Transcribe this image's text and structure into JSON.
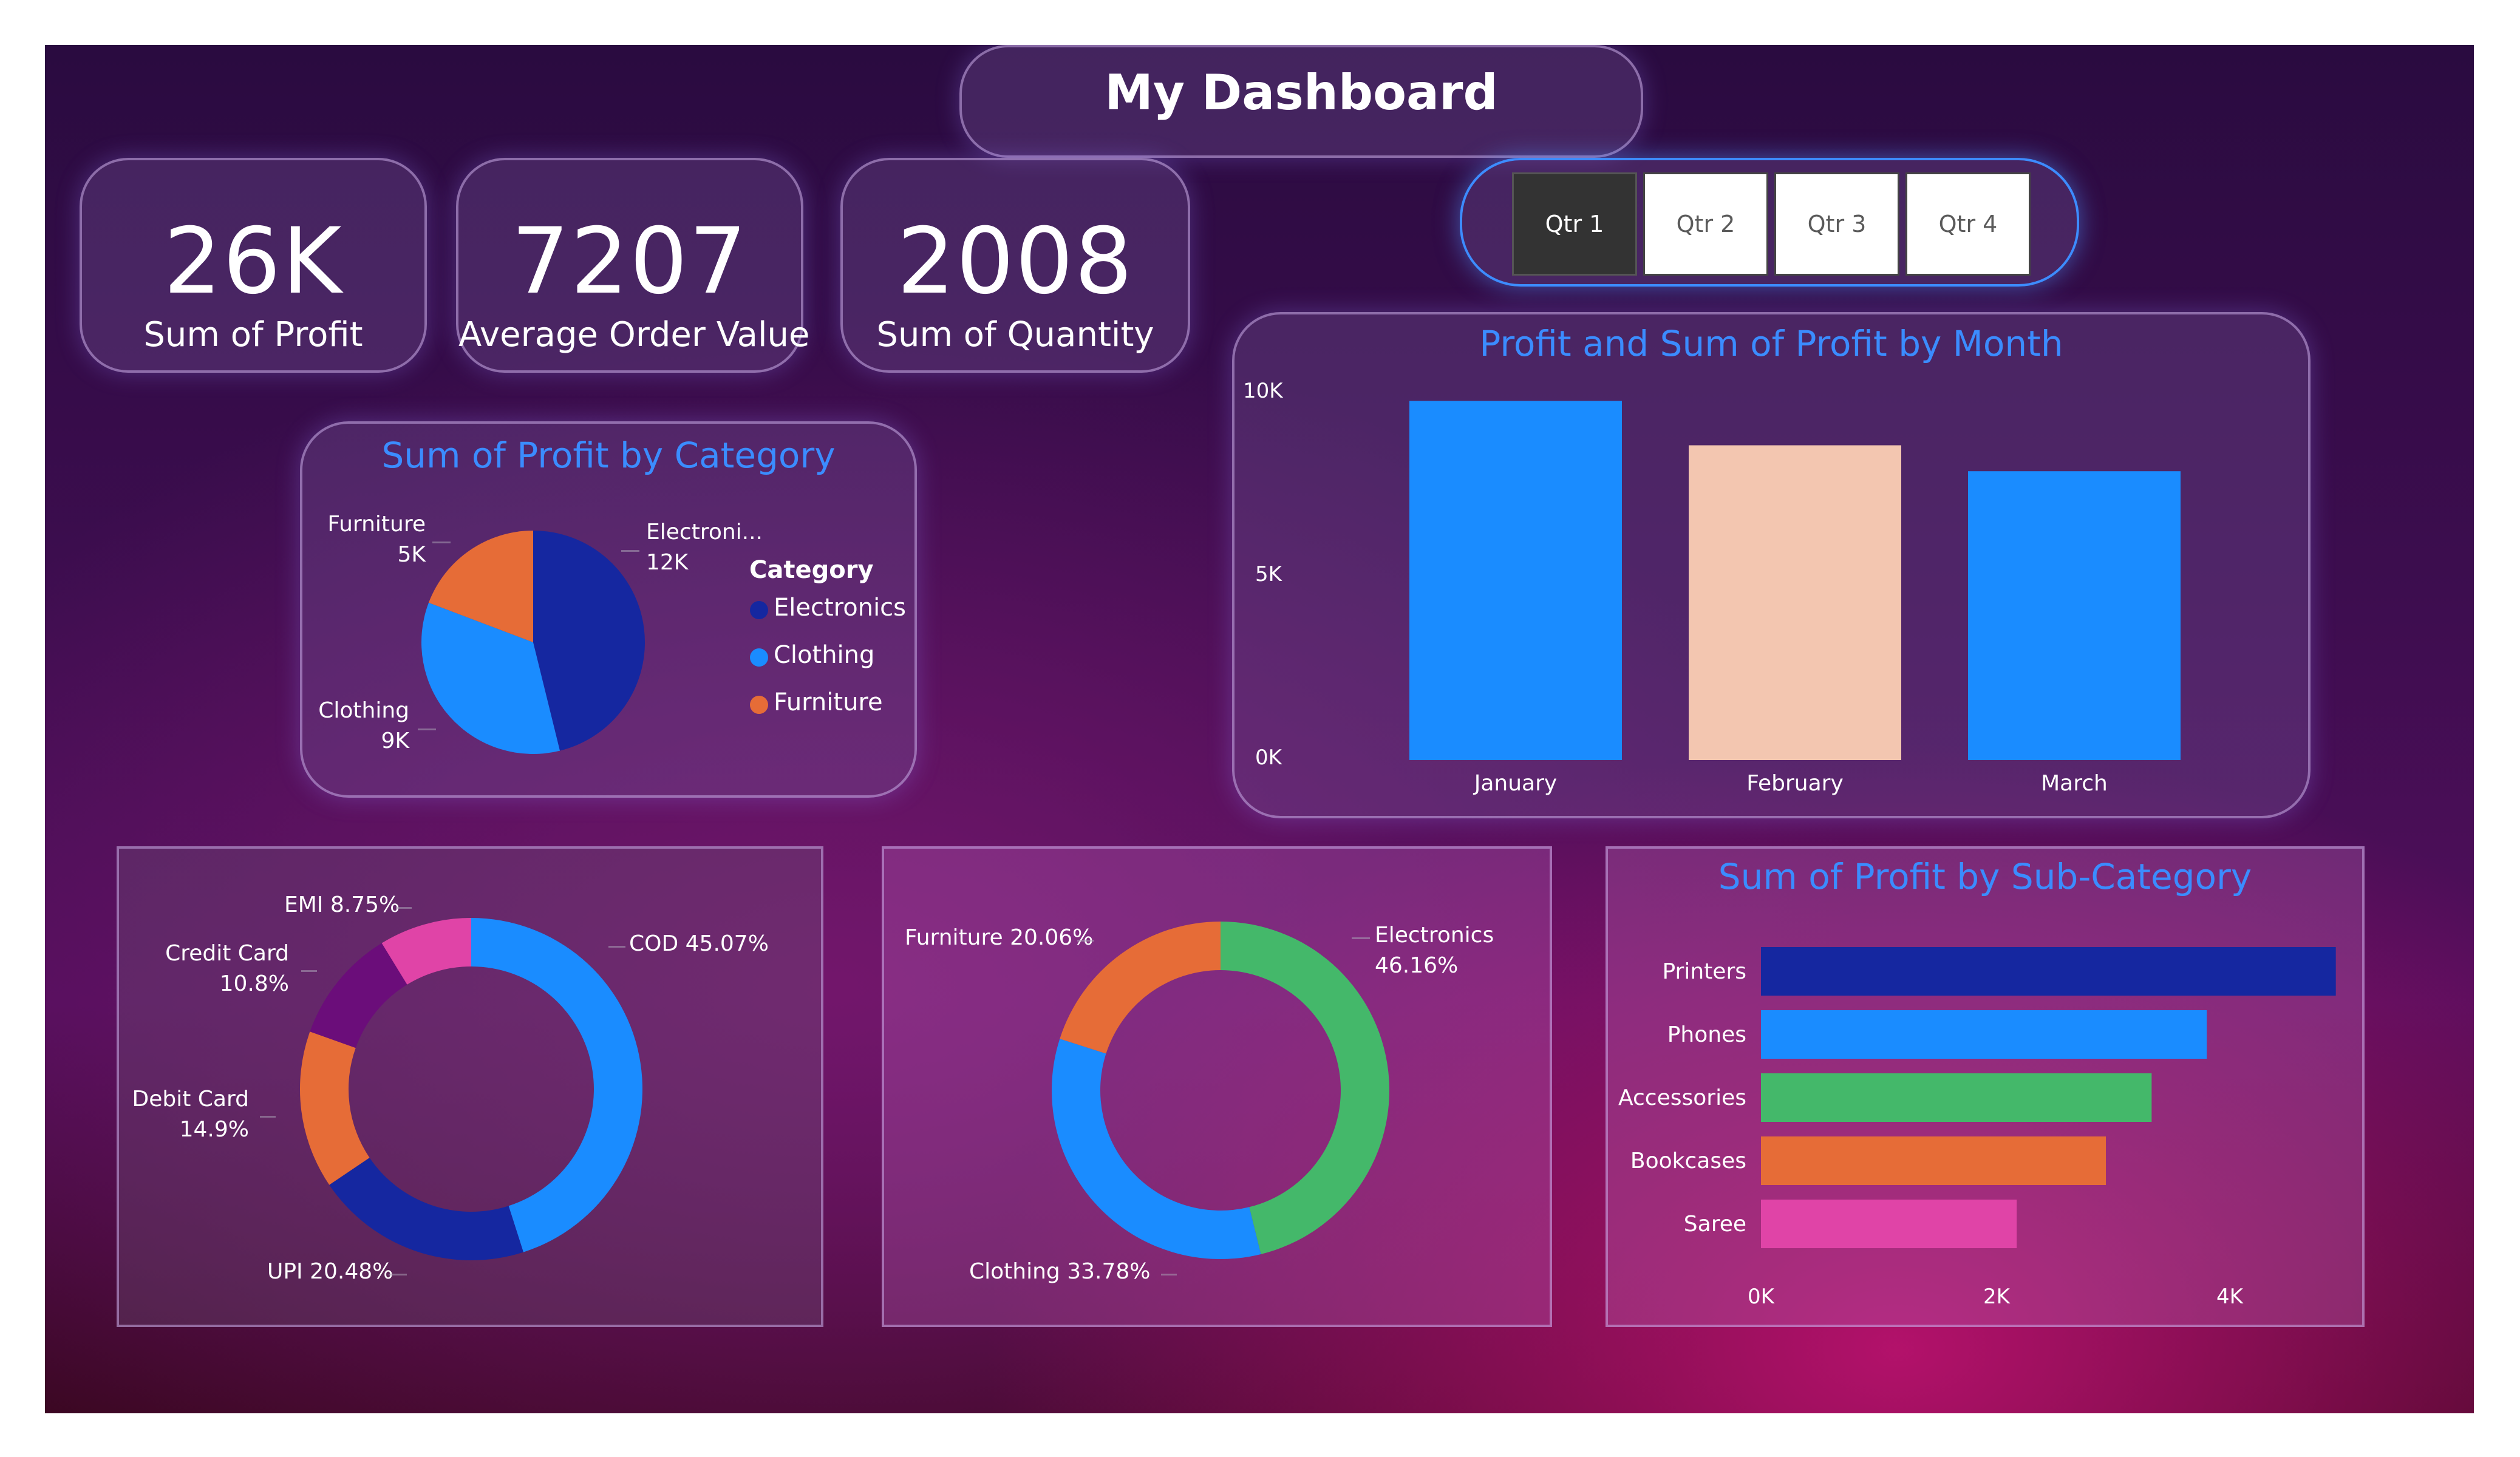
{
  "header": {
    "title": "My Dashboard"
  },
  "kpis": [
    {
      "value": "26K",
      "label": "Sum of Profit"
    },
    {
      "value": "7207",
      "label": "Average Order Value"
    },
    {
      "value": "2008",
      "label": "Sum of Quantity"
    }
  ],
  "slicer": {
    "options": [
      "Qtr 1",
      "Qtr 2",
      "Qtr 3",
      "Qtr 4"
    ],
    "selected": "Qtr 1"
  },
  "category_pie": {
    "title": "Sum of Profit by Category",
    "legend_title": "Category",
    "legend": [
      "Electronics",
      "Clothing",
      "Furniture"
    ],
    "labels": {
      "furniture_name": "Furniture",
      "furniture_value": "5K",
      "electronics_name": "Electroni...",
      "electronics_value": "12K",
      "clothing_name": "Clothing",
      "clothing_value": "9K"
    },
    "colors": {
      "Electronics": "#1527a0",
      "Clothing": "#1a8cff",
      "Furniture": "#e66c37"
    }
  },
  "month_bar": {
    "title": "Profit and Sum of Profit by Month",
    "y_ticks": [
      "10K",
      "5K",
      "0K"
    ],
    "colors": [
      "#1a8cff",
      "#f3c6b0",
      "#1a8cff"
    ]
  },
  "payment_donut": {
    "labels": {
      "emi": "EMI 8.75%",
      "credit_name": "Credit Card",
      "credit_value": "10.8%",
      "debit_name": "Debit Card",
      "debit_value": "14.9%",
      "upi": "UPI 20.48%",
      "cod": "COD 45.07%"
    },
    "colors": {
      "COD": "#1a8cff",
      "UPI": "#1527a0",
      "Debit Card": "#e66c37",
      "Credit Card": "#6b0d7a",
      "EMI": "#e044a7"
    }
  },
  "category_donut": {
    "labels": {
      "furniture": "Furniture 20.06%",
      "electronics_name": "Electronics",
      "electronics_value": "46.16%",
      "clothing": "Clothing 33.78%"
    },
    "colors": {
      "Electronics": "#44b86a",
      "Clothing": "#1a8cff",
      "Furniture": "#e66c37"
    }
  },
  "subcat_bar": {
    "title": "Sum of Profit by Sub-Category",
    "x_ticks": [
      "0K",
      "2K",
      "4K"
    ],
    "colors": [
      "#1527a0",
      "#1a8cff",
      "#44b86a",
      "#e66c37",
      "#e044a7"
    ]
  },
  "chart_data": [
    {
      "type": "pie",
      "title": "Sum of Profit by Category",
      "categories": [
        "Electronics",
        "Clothing",
        "Furniture"
      ],
      "values": [
        12000,
        9000,
        5000
      ]
    },
    {
      "type": "bar",
      "title": "Profit and Sum of Profit by Month",
      "categories": [
        "January",
        "February",
        "March"
      ],
      "values": [
        9700,
        8500,
        7800
      ],
      "ylim": [
        0,
        10000
      ]
    },
    {
      "type": "pie",
      "categories": [
        "COD",
        "UPI",
        "Debit Card",
        "Credit Card",
        "EMI"
      ],
      "values": [
        45.07,
        20.48,
        14.9,
        10.8,
        8.75
      ]
    },
    {
      "type": "pie",
      "categories": [
        "Electronics",
        "Clothing",
        "Furniture"
      ],
      "values": [
        46.16,
        33.78,
        20.06
      ]
    },
    {
      "type": "bar",
      "title": "Sum of Profit by Sub-Category",
      "categories": [
        "Printers",
        "Phones",
        "Accessories",
        "Bookcases",
        "Saree"
      ],
      "values": [
        4900,
        3800,
        3330,
        2940,
        2180
      ],
      "xlim": [
        0,
        5000
      ]
    }
  ]
}
